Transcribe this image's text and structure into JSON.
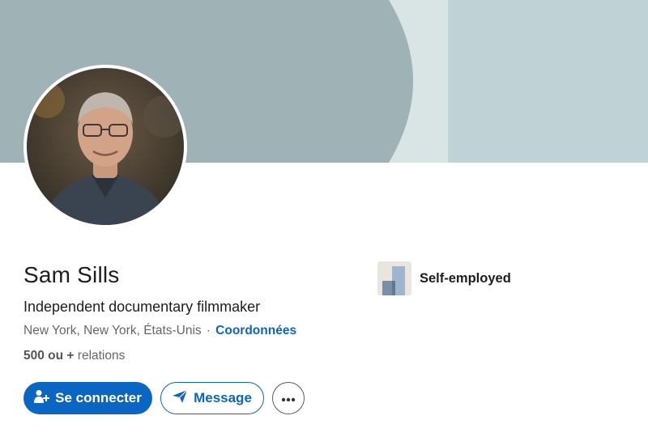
{
  "profile": {
    "name": "Sam Sills",
    "headline": "Independent documentary filmmaker",
    "location": "New York, New York, États-Unis",
    "separator": "·",
    "contact_link": "Coordonnées",
    "connections_count": "500 ou +",
    "connections_label": "relations"
  },
  "employer": {
    "name": "Self-employed",
    "logo_icon": "company-placeholder-icon"
  },
  "actions": {
    "connect_label": "Se connecter",
    "connect_icon": "add-person-icon",
    "message_label": "Message",
    "message_icon": "paper-plane-icon",
    "more_icon": "more-horizontal-icon"
  },
  "colors": {
    "accent": "#0a66c2",
    "banner_dark": "#9fb2b5",
    "banner_mid": "#d9e4e4",
    "banner_light": "#bfd3d7"
  }
}
